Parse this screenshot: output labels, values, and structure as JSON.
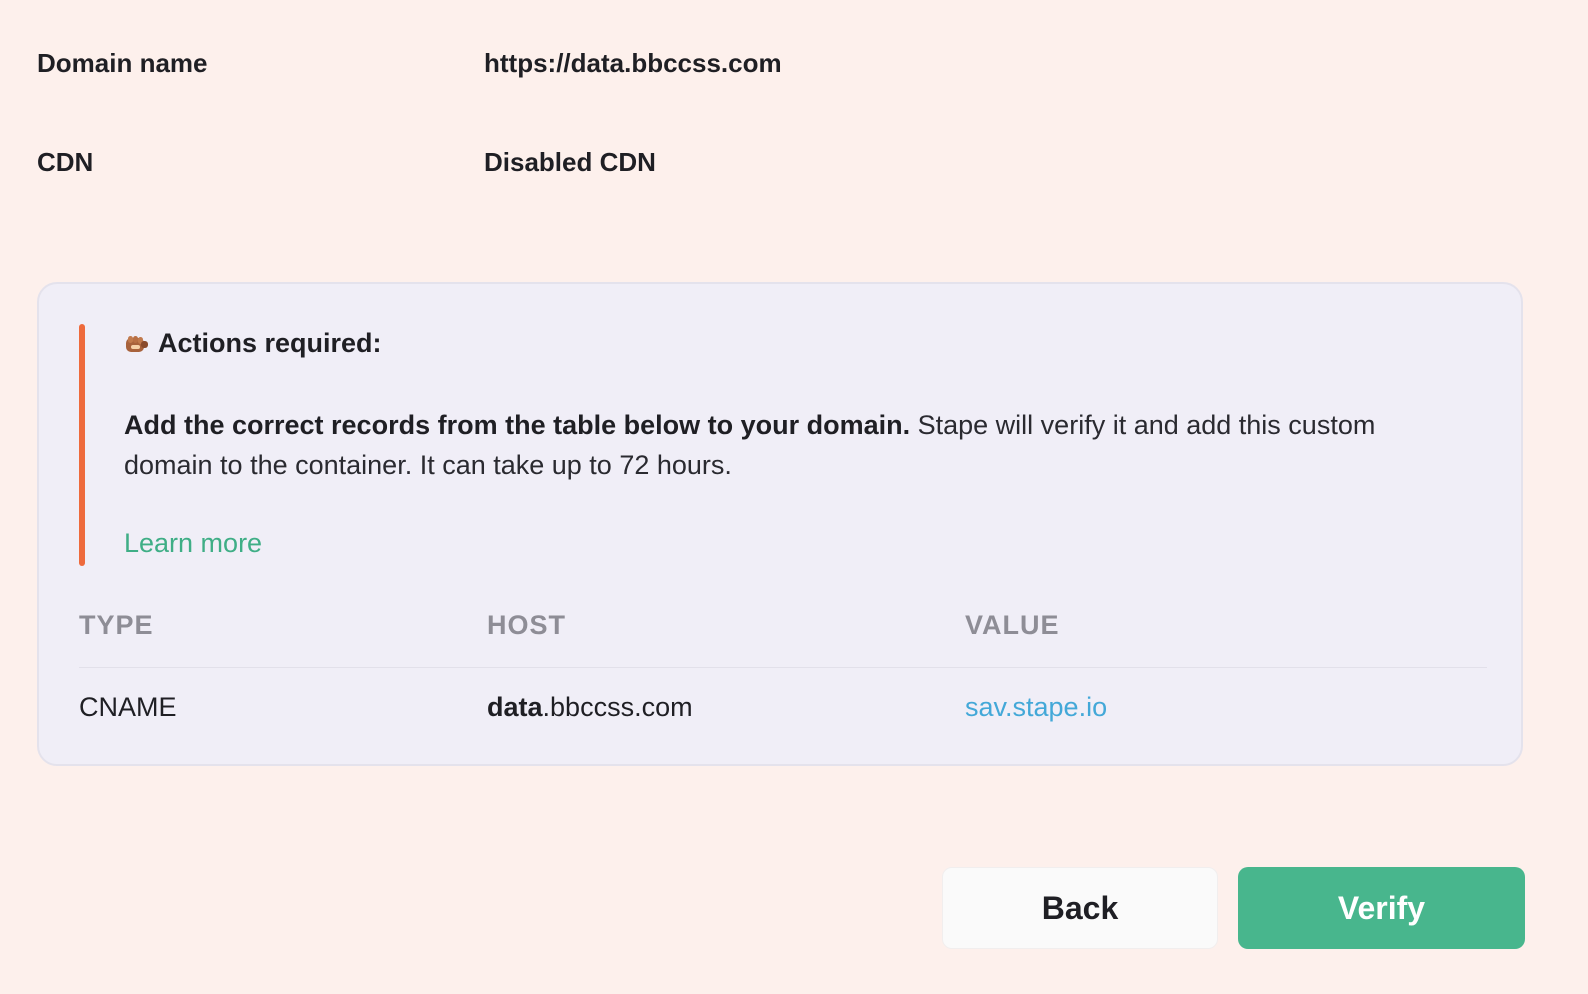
{
  "details": {
    "domain_label": "Domain name",
    "domain_value": "https://data.bbccss.com",
    "cdn_label": "CDN",
    "cdn_value": "Disabled CDN"
  },
  "notice": {
    "icon": "fist-bump-icon",
    "title": "Actions required:",
    "text_bold": "Add the correct records from the table below to your domain.",
    "text_rest": " Stape will verify it and add this custom domain to the container. It can take up to 72 hours.",
    "learn_more": "Learn more",
    "accent_color": "#ee6a3c"
  },
  "records": {
    "headers": [
      "TYPE",
      "HOST",
      "VALUE"
    ],
    "rows": [
      {
        "type": "CNAME",
        "host_bold": "data",
        "host_rest": ".bbccss.com",
        "value": "sav.stape.io"
      }
    ]
  },
  "buttons": {
    "back": "Back",
    "verify": "Verify",
    "verify_color": "#48b68d"
  }
}
